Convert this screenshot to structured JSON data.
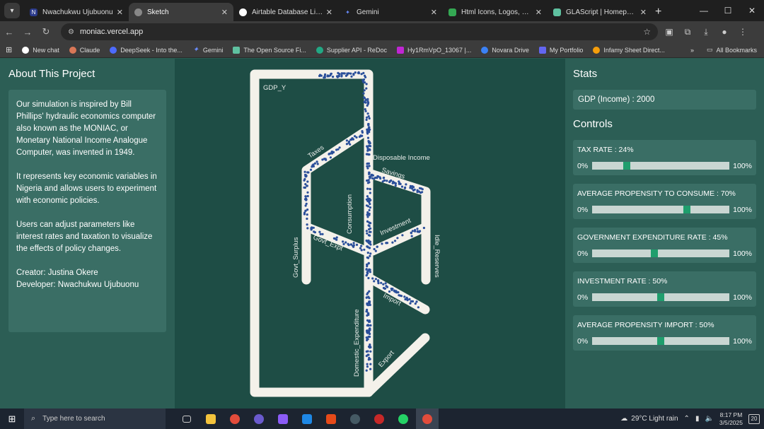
{
  "browser": {
    "tabs": [
      {
        "label": "Nwachukwu Ujubuonu",
        "color": "#2b3a8a",
        "glyph": "N",
        "active": false
      },
      {
        "label": "Sketch",
        "color": "#888888",
        "glyph": "",
        "active": true
      },
      {
        "label": "Airtable Database Limitatio",
        "color": "#ffffff",
        "glyph": "",
        "active": false
      },
      {
        "label": "Gemini",
        "color": "#6a8dff",
        "glyph": "✦",
        "active": false
      },
      {
        "label": "Html Icons, Logos, Symbol",
        "color": "#34a853",
        "glyph": "",
        "active": false
      },
      {
        "label": "GLAScript | Homepholus's",
        "color": "#5fc1a0",
        "glyph": "",
        "active": false
      }
    ],
    "url": "moniac.vercel.app",
    "bookmarks": [
      {
        "label": "New chat",
        "color": "#ffffff"
      },
      {
        "label": "Claude",
        "color": "#d97757"
      },
      {
        "label": "DeepSeek - Into the...",
        "color": "#4d6bfe"
      },
      {
        "label": "Gemini",
        "color": "#6a8dff"
      },
      {
        "label": "The Open Source Fi...",
        "color": "#5fc1a0"
      },
      {
        "label": "Supplier API - ReDoc",
        "color": "#22a884"
      },
      {
        "label": "Hy1RmVpO_13067 |...",
        "color": "#c026d3"
      },
      {
        "label": "Novara Drive",
        "color": "#3b82f6"
      },
      {
        "label": "My Portfolio",
        "color": "#6366f1"
      },
      {
        "label": "Infamy Sheet Direct...",
        "color": "#f59e0b"
      }
    ],
    "all_bookmarks": "All Bookmarks"
  },
  "about": {
    "heading": "About This Project",
    "p1": "Our simulation is inspired by Bill Phillips' hydraulic economics computer also known as the MONIAC, or Monetary National Income Analogue Computer, was invented in 1949.",
    "p2": "It represents key economic variables in Nigeria and allows users to experiment with economic policies.",
    "p3": "Users can adjust parameters like interest rates and taxation to visualize the effects of policy changes.",
    "creator": "Creator: Justina Okere",
    "developer": "Developer: Nwachukwu Ujubuonu"
  },
  "diagram": {
    "labels": {
      "gdp": "GDP_Y",
      "taxes": "Taxes",
      "disposable": "Disposable Income",
      "savings": "Savings",
      "consumption": "Consumption",
      "investment": "Investment",
      "govt_expt": "Govt_Expt",
      "govt_surplus": "Govt_Surplus",
      "idle_reserves": "Idle_Reserves",
      "import": "Import",
      "domestic": "Domestic_Expenditure",
      "export": "Export"
    },
    "pipe_color": "#f4f1ea",
    "particle_color": "#2a4f9a"
  },
  "stats": {
    "heading": "Stats",
    "gdp": "GDP (Income) : 2000"
  },
  "controls": {
    "heading": "Controls",
    "min_label": "0%",
    "max_label": "100%",
    "items": [
      {
        "label": "TAX RATE : 24%",
        "value": 24
      },
      {
        "label": "AVERAGE PROPENSITY TO CONSUME : 70%",
        "value": 70
      },
      {
        "label": "GOVERNMENT EXPENDITURE RATE : 45%",
        "value": 45
      },
      {
        "label": "INVESTMENT RATE : 50%",
        "value": 50
      },
      {
        "label": "AVERAGE PROPENSITY IMPORT : 50%",
        "value": 50
      }
    ]
  },
  "taskbar": {
    "search_placeholder": "Type here to search",
    "weather": "29°C  Light rain",
    "time": "8:17 PM",
    "date": "3/5/2025",
    "notifications": "20"
  }
}
